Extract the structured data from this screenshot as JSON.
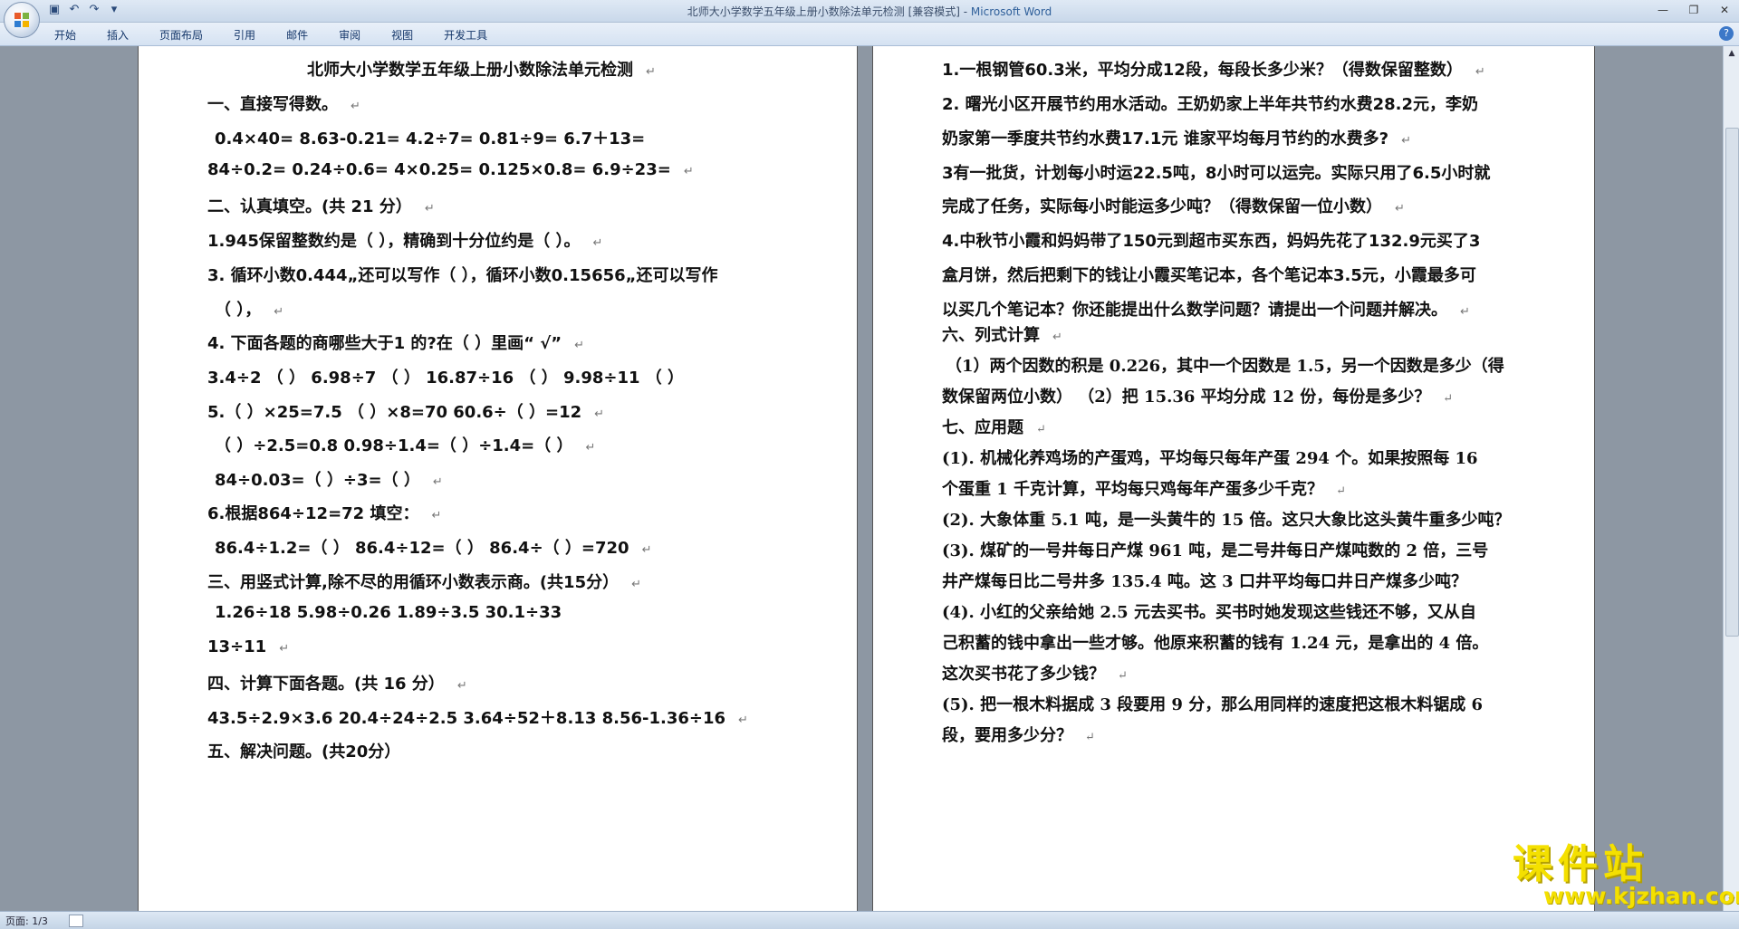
{
  "window": {
    "title_doc": "北师大小学数学五年级上册小数除法单元检测 [兼容模式] - ",
    "title_app": "Microsoft Word"
  },
  "ribbon": {
    "tabs": [
      "开始",
      "插入",
      "页面布局",
      "引用",
      "邮件",
      "审阅",
      "视图",
      "开发工具"
    ]
  },
  "statusbar": {
    "page": "页面: 1/3"
  },
  "watermark": {
    "main": "课件站",
    "url": "www.kjzhan.com"
  },
  "left_page": {
    "lines": [
      "北师大小学数学五年级上册小数除法单元检测",
      "一、直接写得数。",
      "0.4×40=     8.63-0.21=     4.2÷7=      0.81÷9=           6.7＋13=",
      "84÷0.2=      0.24÷0.6=    4×0.25=     0.125×0.8=       6.9÷23=",
      "二、认真填空。(共 21 分）",
      "1.945保留整数约是（       ），精确到十分位约是（        ）。",
      "3. 循环小数0.444„还可以写作（       ），循环小数0.15656„还可以写作",
      "（         ），",
      "4. 下面各题的商哪些大于1 的?在（    ）里画“ √”",
      "3.4÷2  （     ） 6.98÷7    （     ）  16.87÷16  （    ）  9.98÷11    （    ）",
      "5.（     ）×25=7.5      （         ）×8=70          60.6÷（        ）=12",
      "（      ）÷2.5=0.8     0.98÷1.4=（       ）÷1.4=（          ）",
      "84÷0.03=（         ）÷3=（          ）",
      "6.根据864÷12=72 填空：",
      "86.4÷1.2=（       ）      86.4÷12=（        ）       86.4÷（          ）=720",
      "三、用竖式计算,除不尽的用循环小数表示商。(共15分）",
      "1.26÷18              5.98÷0.26             1.89÷3.5              30.1÷33",
      "13÷11",
      "四、计算下面各题。(共 16    分）",
      "43.5÷2.9×3.6      20.4÷24÷2.5      3.64÷52＋8.13      8.56-1.36÷16",
      "五、解决问题。(共20分）"
    ]
  },
  "right_page": {
    "lines": [
      "1.一根钢管60.3米，平均分成12段，每段长多少米？（得数保留整数）",
      "2.  曙光小区开展节约用水活动。王奶奶家上半年共节约水费28.2元，李奶",
      "奶家第一季度共节约水费17.1元       谁家平均每月节约的水费多?",
      "3有一批货，计划每小时运22.5吨，8小时可以运完。实际只用了6.5小时就",
      "完成了任务，实际每小时能运多少吨？（得数保留一位小数）",
      "4.中秋节小霞和妈妈带了150元到超市买东西，妈妈先花了132.9元买了3",
      "盒月饼，然后把剩下的钱让小霞买笔记本，各个笔记本3.5元，小霞最多可",
      "以买几个笔记本？你还能提出什么数学问题？请提出一个问题并解决。",
      "六、列式计算",
      "（1）两个因数的积是 0.226，其中一个因数是 1.5，另一个因数是多少（得",
      "数保留两位小数）         （2）把 15.36 平均分成 12 份，每份是多少？",
      "七、应用题",
      "(1). 机械化养鸡场的产蛋鸡，平均每只每年产蛋  294 个。如果按照每  16",
      "个蛋重 1 千克计算，平均每只鸡每年产蛋多少千克？",
      "(2). 大象体重 5.1 吨，是一头黄牛的 15 倍。这只大象比这头黄牛重多少吨？",
      "(3).  煤矿的一号井每日产煤 961 吨，是二号井每日产煤吨数的 2 倍，三号",
      "井产煤每日比二号井多 135.4 吨。这 3 口井平均每口井日产煤多少吨？",
      "(4).  小红的父亲给她 2.5 元去买书。买书时她发现这些钱还不够，又从自",
      "己积蓄的钱中拿出一些才够。他原来积蓄的钱有 1.24 元，是拿出的 4 倍。",
      "这次买书花了多少钱？",
      "(5).  把一根木料据成 3 段要用 9 分，那么用同样的速度把这根木料锯成 6",
      "段，要用多少分？"
    ]
  }
}
